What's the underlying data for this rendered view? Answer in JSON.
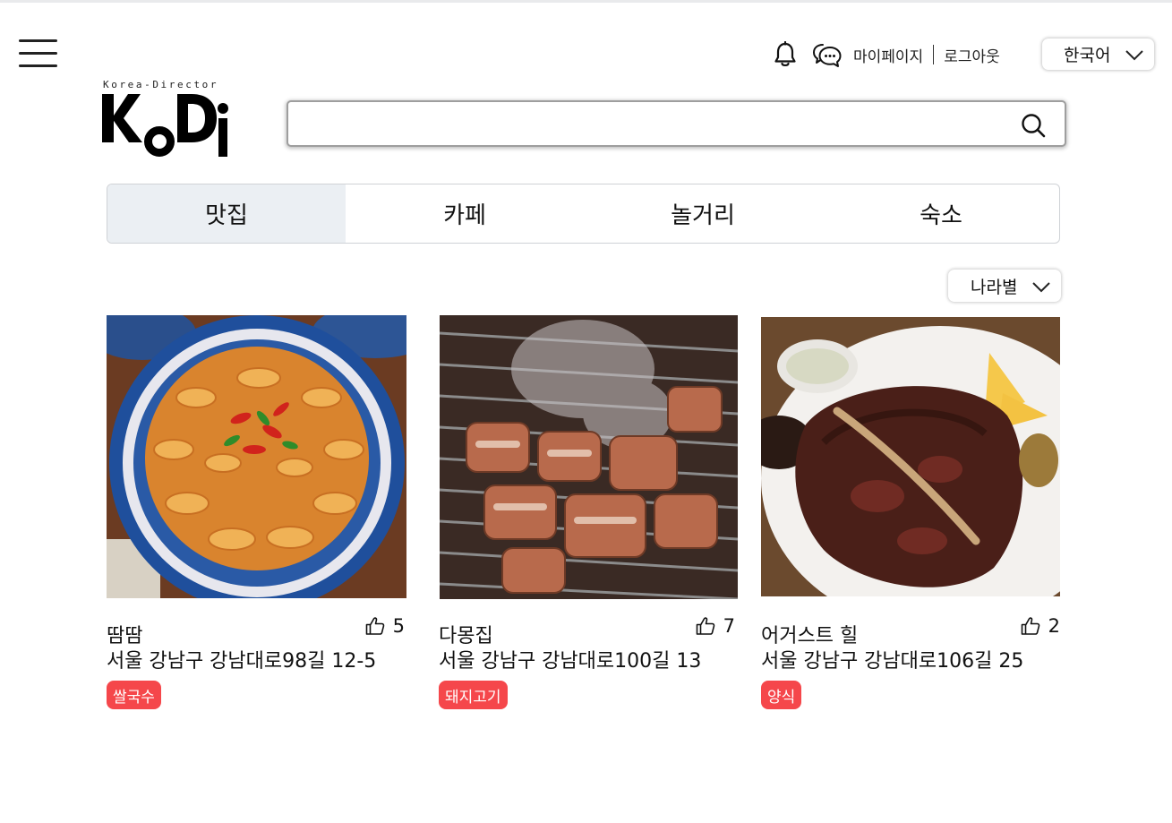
{
  "header": {
    "menu_icon": "hamburger-menu-icon",
    "notification_icon": "bell-icon",
    "chat_icon": "chat-bubble-icon",
    "mypage_label": "마이페이지",
    "logout_label": "로그아웃",
    "language": {
      "selected": "한국어",
      "icon": "chevron-down-icon"
    }
  },
  "logo": {
    "tagline": "Korea-Director",
    "wordmark": "KoDi"
  },
  "search": {
    "value": "",
    "placeholder": "",
    "icon": "search-icon"
  },
  "tabs": [
    {
      "label": "맛집",
      "active": true
    },
    {
      "label": "카페",
      "active": false
    },
    {
      "label": "놀거리",
      "active": false
    },
    {
      "label": "숙소",
      "active": false
    }
  ],
  "sort": {
    "selected": "나라별",
    "icon": "chevron-down-icon"
  },
  "cards": [
    {
      "name": "땀땀",
      "address": "서울 강남구 강남대로98길 12-5",
      "likes": "5",
      "tag": "쌀국수",
      "image": "spicy-beef-tripe-rice-noodle-photo"
    },
    {
      "name": "다몽집",
      "address": "서울 강남구 강남대로100길 13",
      "likes": "7",
      "tag": "돼지고기",
      "image": "grilled-pork-on-grill-photo"
    },
    {
      "name": "어거스트 힐",
      "address": "서울 강남구 강남대로106길 25",
      "likes": "2",
      "tag": "양식",
      "image": "t-bone-steak-photo"
    }
  ],
  "colors": {
    "tag_bg": "#f5474b",
    "tab_active_bg": "#ebeff3",
    "text": "#111111"
  }
}
